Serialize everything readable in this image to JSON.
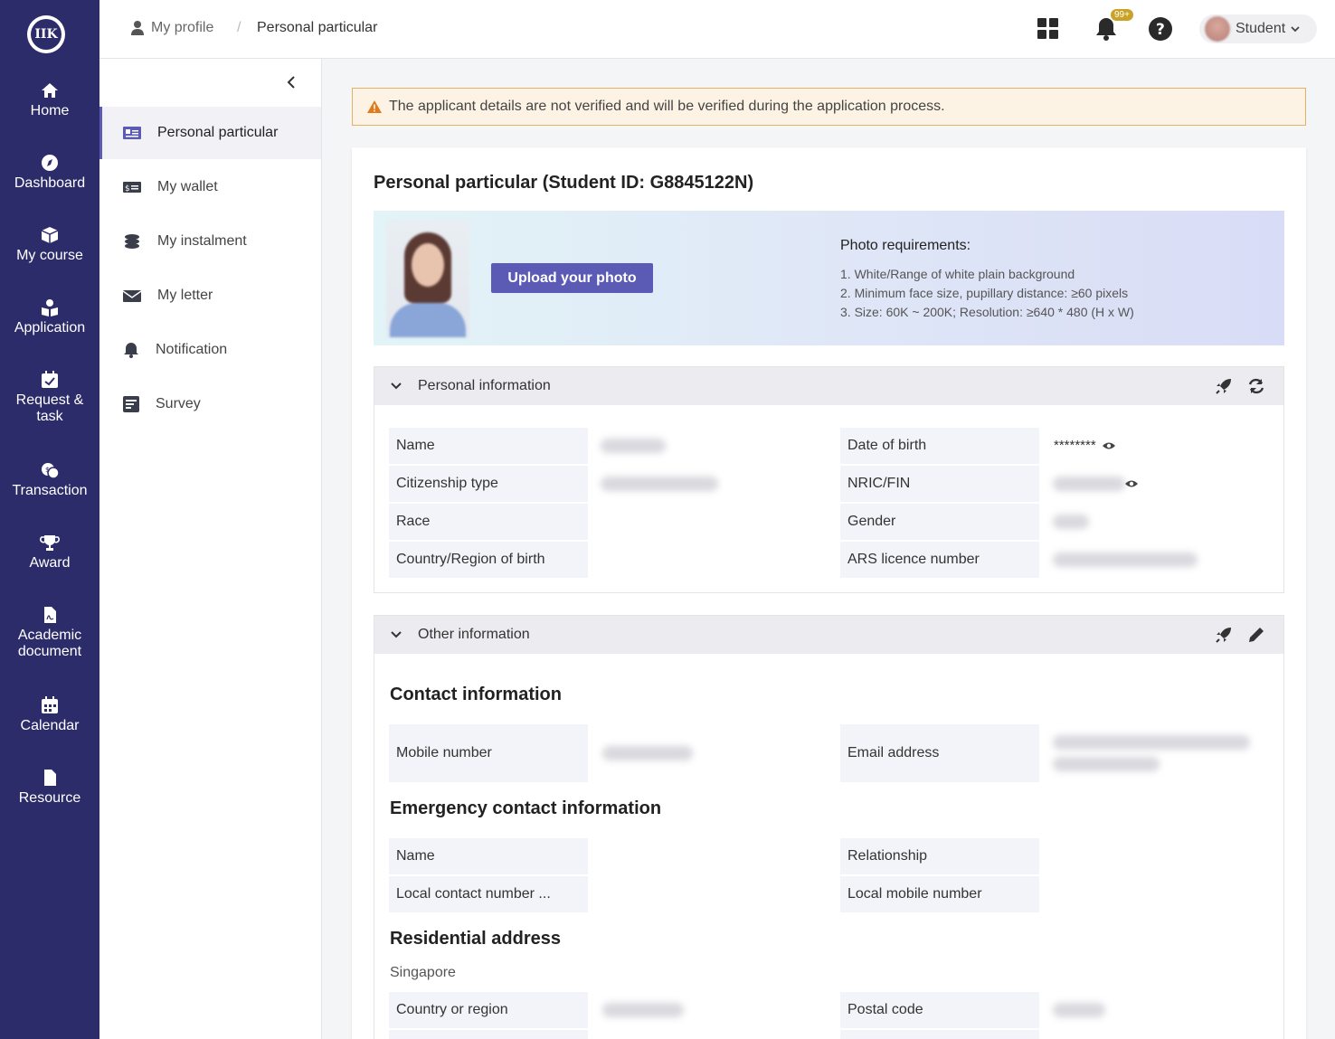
{
  "nav": {
    "logo_text": "IIK",
    "items": [
      {
        "label": "Home"
      },
      {
        "label": "Dashboard"
      },
      {
        "label": "My course"
      },
      {
        "label": "Application"
      },
      {
        "label": "Request & task"
      },
      {
        "label": "Transaction"
      },
      {
        "label": "Award"
      },
      {
        "label": "Academic document"
      },
      {
        "label": "Calendar"
      },
      {
        "label": "Resource"
      }
    ]
  },
  "topbar": {
    "breadcrumb": [
      "My profile",
      "Personal particular"
    ],
    "notification_badge": "99+",
    "user_role": "Student"
  },
  "subnav": {
    "items": [
      {
        "label": "Personal particular"
      },
      {
        "label": "My wallet"
      },
      {
        "label": "My instalment"
      },
      {
        "label": "My letter"
      },
      {
        "label": "Notification"
      },
      {
        "label": "Survey"
      }
    ]
  },
  "alert": {
    "text": "The applicant details are not verified and will be verified during the application process."
  },
  "card": {
    "title": "Personal particular (Student ID: G8845122N)",
    "upload_button": "Upload your photo",
    "requirements_title": "Photo requirements:",
    "requirements": [
      "1. White/Range of white plain background",
      "2. Minimum face size, pupillary distance: ≥60 pixels",
      "3. Size: 60K ~ 200K; Resolution: ≥640 * 480 (H x W)"
    ]
  },
  "personal_info": {
    "title": "Personal information",
    "labels": {
      "name": "Name",
      "citizenship": "Citizenship type",
      "race": "Race",
      "country_birth": "Country/Region of birth",
      "dob": "Date of birth",
      "nric": "NRIC/FIN",
      "gender": "Gender",
      "ars": "ARS licence number"
    },
    "dob_masked": "********"
  },
  "other_info": {
    "title": "Other information",
    "contact_heading": "Contact information",
    "mobile_label": "Mobile number",
    "email_label": "Email address",
    "emergency_heading": "Emergency contact information",
    "em_name_label": "Name",
    "em_relationship_label": "Relationship",
    "em_local_contact_label": "Local contact number ...",
    "em_local_mobile_label": "Local mobile number",
    "residential_heading": "Residential address",
    "residential_country": "Singapore",
    "country_region_label": "Country or region",
    "postal_code_label": "Postal code"
  },
  "colors": {
    "nav_bg": "#2d2c6a",
    "accent": "#5b5bb5",
    "alert_bg": "#fdf3e4",
    "alert_border": "#e6b163",
    "badge": "#c9a227"
  }
}
